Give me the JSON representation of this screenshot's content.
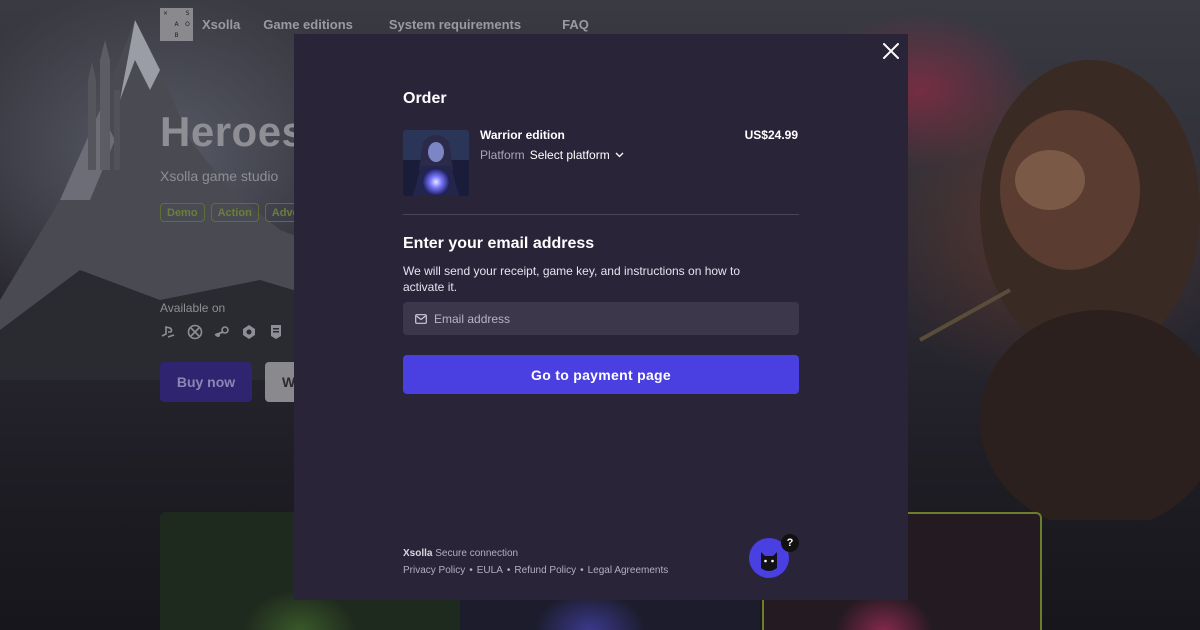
{
  "nav": {
    "logo_glyphs": [
      "×",
      "",
      "S",
      "",
      "A",
      "O",
      "",
      "B",
      ""
    ],
    "brand": "Xsolla",
    "links": [
      "Game editions",
      "System requirements",
      "FAQ"
    ]
  },
  "hero": {
    "title": "Heroes",
    "studio": "Xsolla game studio",
    "tags": [
      "Demo",
      "Action",
      "Adve"
    ],
    "available_on": "Available on",
    "platform_icons": [
      "playstation-icon",
      "xbox-icon",
      "steam-icon",
      "gog-icon",
      "epic-games-icon"
    ],
    "buy_label": "Buy now",
    "wishlist_label_partial": "W"
  },
  "modal": {
    "order_title": "Order",
    "item": {
      "name": "Warrior edition",
      "price": "US$24.99",
      "platform_label": "Platform",
      "platform_value": "Select platform"
    },
    "email": {
      "title": "Enter your email address",
      "description": "We will send your receipt, game key, and instructions on how to activate it.",
      "placeholder": "Email address",
      "value": ""
    },
    "pay_button": "Go to payment page",
    "footer": {
      "brand": "Xsolla",
      "secure": "Secure connection",
      "links": [
        "Privacy Policy",
        "EULA",
        "Refund Policy",
        "Legal Agreements"
      ]
    },
    "help_badge": "?"
  },
  "colors": {
    "modal_bg": "#2a2438",
    "accent": "#4a3fe0",
    "input_bg": "#3d374b",
    "tag_green": "#6d7d3d"
  }
}
